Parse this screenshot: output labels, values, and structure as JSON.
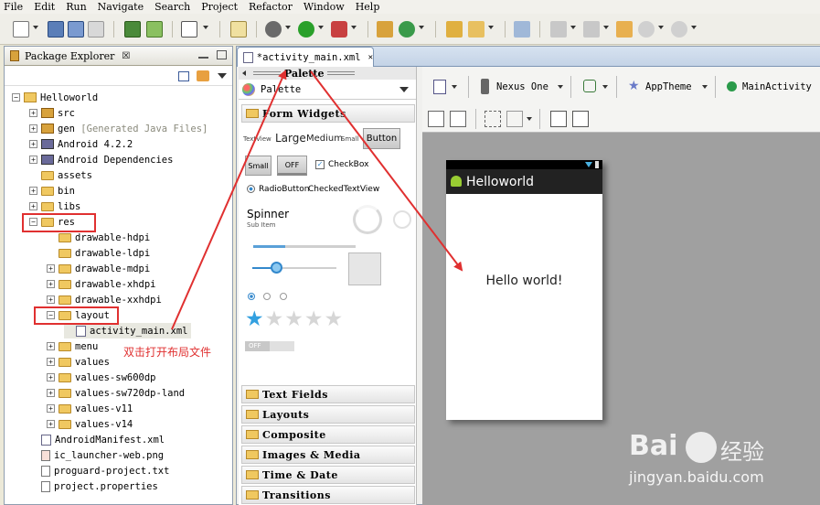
{
  "menu": [
    "File",
    "Edit",
    "Run",
    "Navigate",
    "Search",
    "Project",
    "Refactor",
    "Window",
    "Help"
  ],
  "package_explorer": {
    "tab_title": "Package Explorer",
    "tab_close": "☒",
    "tree": [
      {
        "label": "Helloworld",
        "extra": ""
      },
      {
        "label": "src",
        "extra": ""
      },
      {
        "label": "gen",
        "extra": "[Generated Java Files]"
      },
      {
        "label": "Android 4.2.2",
        "extra": ""
      },
      {
        "label": "Android Dependencies",
        "extra": ""
      },
      {
        "label": "assets",
        "extra": ""
      },
      {
        "label": "bin",
        "extra": ""
      },
      {
        "label": "libs",
        "extra": ""
      },
      {
        "label": "res",
        "extra": ""
      },
      {
        "label": "drawable-hdpi",
        "extra": ""
      },
      {
        "label": "drawable-ldpi",
        "extra": ""
      },
      {
        "label": "drawable-mdpi",
        "extra": ""
      },
      {
        "label": "drawable-xhdpi",
        "extra": ""
      },
      {
        "label": "drawable-xxhdpi",
        "extra": ""
      },
      {
        "label": "layout",
        "extra": ""
      },
      {
        "label": "activity_main.xml",
        "extra": ""
      },
      {
        "label": "menu",
        "extra": ""
      },
      {
        "label": "values",
        "extra": ""
      },
      {
        "label": "values-sw600dp",
        "extra": ""
      },
      {
        "label": "values-sw720dp-land",
        "extra": ""
      },
      {
        "label": "values-v11",
        "extra": ""
      },
      {
        "label": "values-v14",
        "extra": ""
      },
      {
        "label": "AndroidManifest.xml",
        "extra": ""
      },
      {
        "label": "ic_launcher-web.png",
        "extra": ""
      },
      {
        "label": "proguard-project.txt",
        "extra": ""
      },
      {
        "label": "project.properties",
        "extra": ""
      }
    ]
  },
  "annotation": "双击打开布局文件",
  "editor": {
    "tab_title": "*activity_main.xml",
    "palette_header": "Palette",
    "palette_combo": "Palette",
    "categories": [
      "Form Widgets",
      "Text Fields",
      "Layouts",
      "Composite",
      "Images & Media",
      "Time & Date",
      "Transitions"
    ],
    "widgets": {
      "textview": "TextView",
      "large": "Large",
      "medium": "Medium",
      "small": "Small",
      "button": "Button",
      "small_button": "Small",
      "toggle_off": "OFF",
      "checkbox": "CheckBox",
      "radiobutton": "RadioButton",
      "checkedtextview": "CheckedTextView",
      "spinner": "Spinner",
      "spinner_sub": "Sub Item",
      "switch_off": "OFF",
      "rating_filled": 1,
      "rating_total": 5
    },
    "layout_toolbar": {
      "device": "Nexus One",
      "theme": "AppTheme",
      "activity": "MainActivity"
    },
    "phone": {
      "app_title": "Helloworld",
      "content_text": "Hello world!"
    }
  },
  "watermark": {
    "brand": "Bai",
    "brand_cn": "经验",
    "url": "jingyan.baidu.com"
  },
  "colors": {
    "annotation_red": "#e03030",
    "canvas_gray": "#a0a0a0",
    "rating_blue": "#33a0e0"
  }
}
